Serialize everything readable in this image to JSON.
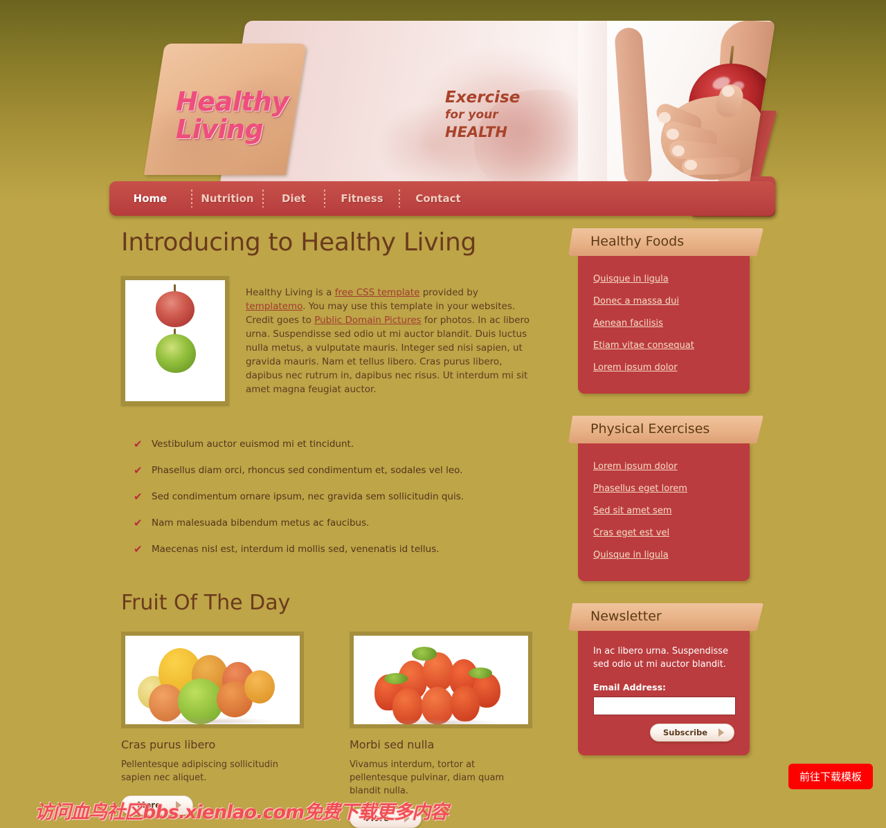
{
  "site": {
    "logo_line1": "Healthy",
    "logo_line2": "Living",
    "banner_line1": "Exercise",
    "banner_line2": "for your",
    "banner_line3": "HEALTH",
    "accent_red": "#bb3c3e",
    "accent_gold": "#bda548",
    "accent_peach": "#e8b287",
    "heading_brown": "#6b3a1c"
  },
  "nav": {
    "items": [
      {
        "label": "Home",
        "active": true
      },
      {
        "label": "Nutrition",
        "active": false
      },
      {
        "label": "Diet",
        "active": false
      },
      {
        "label": "Fitness",
        "active": false
      },
      {
        "label": "Contact",
        "active": false
      }
    ]
  },
  "main": {
    "page_title": "Introducing to Healthy Living",
    "intro": {
      "p1": "Healthy Living is a ",
      "link1": "free CSS template",
      "p2": " provided by ",
      "link2": "templatemo",
      "p3": ". You may use this template in your websites. Credit goes to ",
      "link3": "Public Domain Pictures",
      "p4": " for photos. In ac libero urna. Suspendisse sed odio ut mi auctor blandit. Duis luctus nulla metus, a vulputate mauris. Integer sed nisi sapien, ut gravida mauris. Nam et tellus libero. Cras purus libero, dapibus nec rutrum in, dapibus nec risus. Ut interdum mi sit amet magna feugiat auctor."
    },
    "checklist": [
      "Vestibulum auctor euismod mi et tincidunt.",
      "Phasellus diam orci, rhoncus sed condimentum et, sodales vel leo.",
      "Sed condimentum ornare ipsum, nec gravida sem sollicitudin quis.",
      "Nam malesuada bibendum metus ac faucibus.",
      "Maecenas nisl est, interdum id mollis sed, venenatis id tellus."
    ],
    "fruit_section_title": "Fruit Of The Day",
    "fruit_items": [
      {
        "title": "Cras purus libero",
        "desc": "Pellentesque adipiscing sollicitudin sapien nec aliquet.",
        "more_label": "More"
      },
      {
        "title": "Morbi sed nulla",
        "desc": "Vivamus interdum, tortor at pellentesque pulvinar, diam quam blandit nulla.",
        "more_label": "More"
      }
    ]
  },
  "sidebar": {
    "blocks": [
      {
        "title": "Healthy Foods",
        "links": [
          "Quisque in ligula",
          "Donec a massa dui",
          "Aenean facilisis",
          "Etiam vitae consequat",
          "Lorem ipsum dolor"
        ]
      },
      {
        "title": "Physical Exercises",
        "links": [
          "Lorem ipsum dolor",
          "Phasellus eget lorem",
          "Sed sit amet sem",
          "Cras eget est vel",
          "Quisque in ligula"
        ]
      }
    ],
    "newsletter": {
      "title": "Newsletter",
      "text": "In ac libero urna. Suspendisse sed odio ut mi auctor blandit.",
      "label": "Email Address:",
      "input_value": "",
      "input_placeholder": "",
      "button_label": "Subscribe"
    }
  },
  "overlay": {
    "watermark": "访问血鸟社区bbs.xienlao.com免费下载更多内容",
    "download_button": "前往下载模板"
  }
}
